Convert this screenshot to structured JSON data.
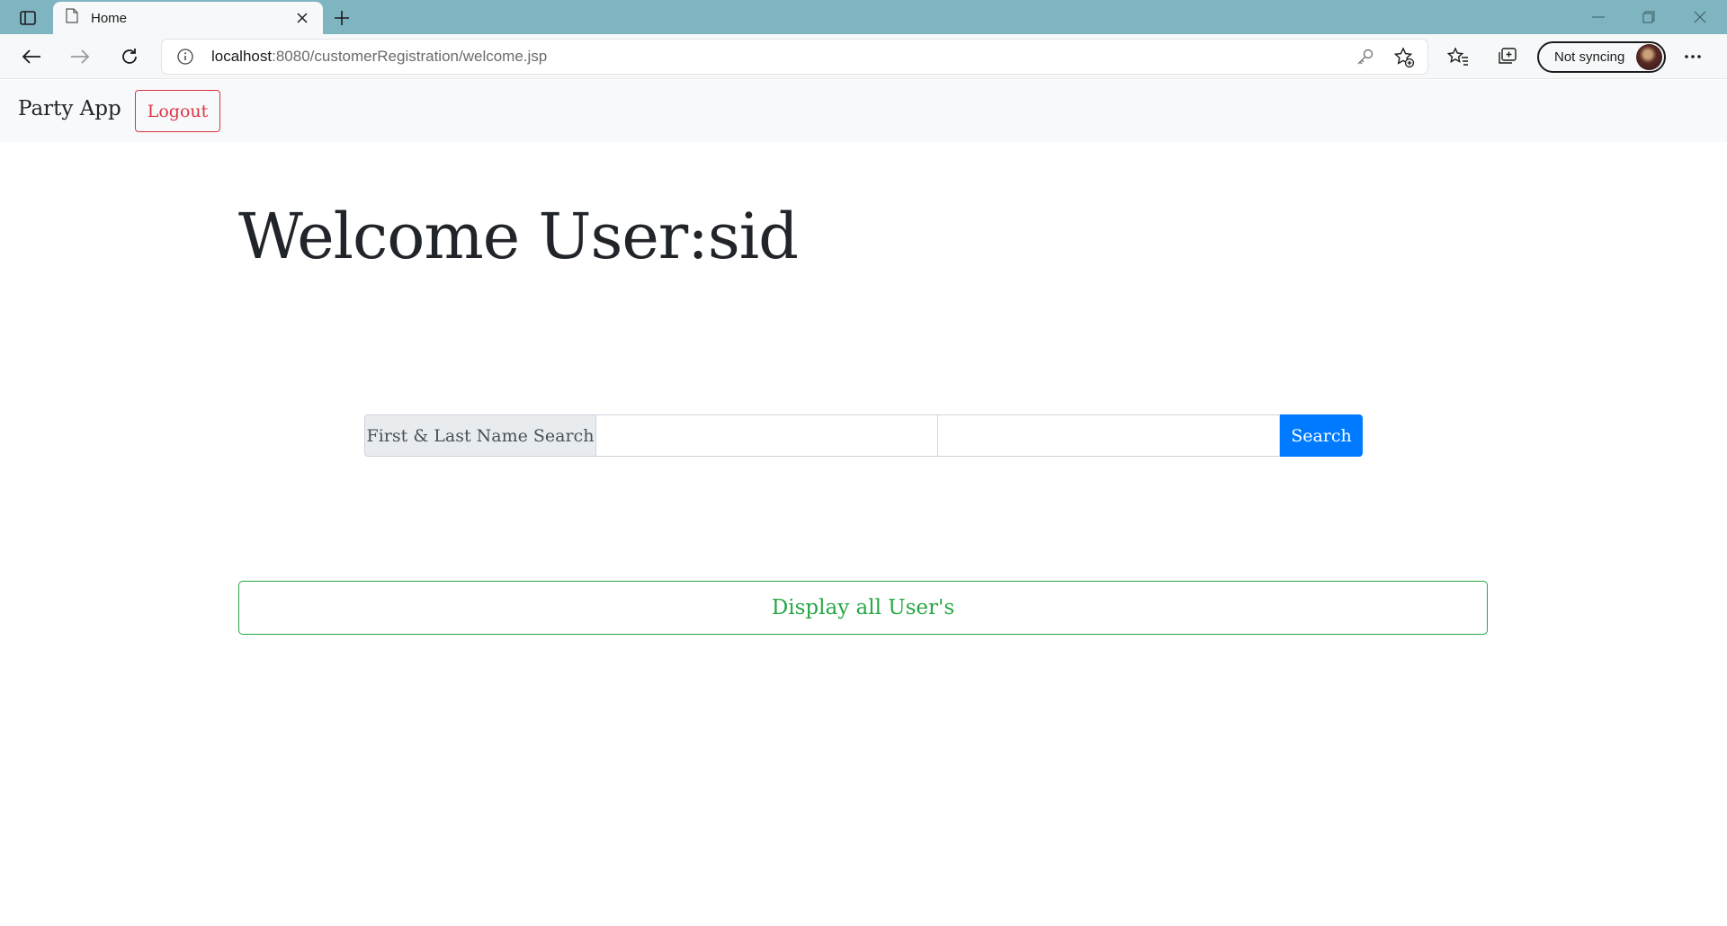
{
  "browser": {
    "tab": {
      "title": "Home"
    },
    "address": {
      "host": "localhost",
      "rest": ":8080/customerRegistration/welcome.jsp"
    },
    "profile": {
      "label": "Not syncing"
    }
  },
  "navbar": {
    "brand": "Party App",
    "logout_label": "Logout"
  },
  "main": {
    "heading": "Welcome User:sid",
    "search": {
      "prepend_label": "First & Last Name Search",
      "first_name_value": "",
      "last_name_value": "",
      "button_label": "Search"
    },
    "display_all_label": "Display all User's"
  },
  "colors": {
    "tabstrip": "#7fb5c0",
    "danger": "#dc3545",
    "primary": "#007bff",
    "success": "#28a745"
  }
}
